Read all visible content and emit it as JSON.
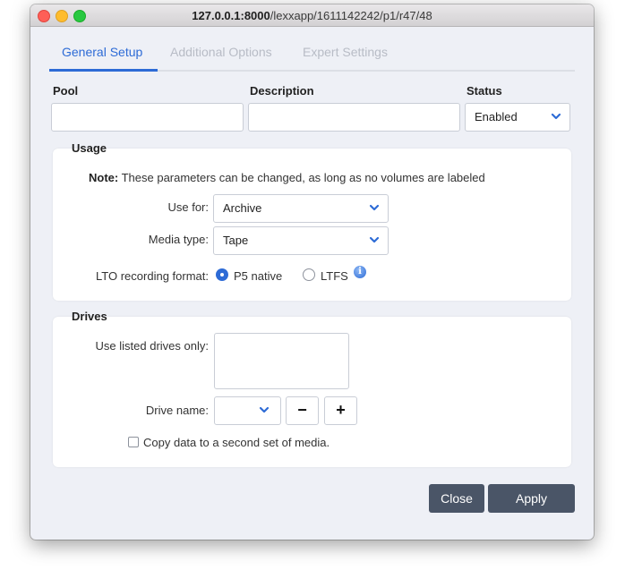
{
  "window": {
    "title_host": "127.0.0.1:8000",
    "title_path": "/lexxapp/1611142242/p1/r47/48"
  },
  "tabs": [
    {
      "label": "General Setup",
      "active": true
    },
    {
      "label": "Additional Options",
      "active": false
    },
    {
      "label": "Expert Settings",
      "active": false
    }
  ],
  "general": {
    "pool_label": "Pool",
    "pool_value": "",
    "description_label": "Description",
    "description_value": "",
    "status_label": "Status",
    "status_value": "Enabled"
  },
  "usage": {
    "legend": "Usage",
    "note_prefix": "Note:",
    "note_text": " These parameters can be changed, as long as no volumes are labeled",
    "use_for_label": "Use for:",
    "use_for_value": "Archive",
    "media_type_label": "Media type:",
    "media_type_value": "Tape",
    "lto_label": "LTO recording format:",
    "lto_options": [
      {
        "label": "P5 native",
        "selected": true
      },
      {
        "label": "LTFS",
        "selected": false
      }
    ],
    "info_glyph": "i"
  },
  "drives": {
    "legend": "Drives",
    "use_listed_label": "Use listed drives only:",
    "drive_name_label": "Drive name:",
    "drive_name_value": "",
    "minus_glyph": "−",
    "plus_glyph": "+",
    "copy_label": "Copy data to a second set of media.",
    "copy_checked": false
  },
  "footer": {
    "close_label": "Close",
    "apply_label": "Apply"
  },
  "colors": {
    "accent": "#2d6bd6",
    "button_bg": "#4a5567",
    "window_bg": "#eef0f6"
  }
}
